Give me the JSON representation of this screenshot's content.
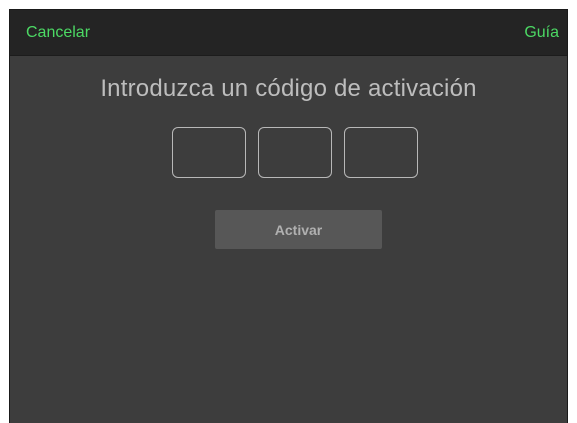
{
  "navbar": {
    "cancel_label": "Cancelar",
    "guide_label": "Guía"
  },
  "main": {
    "title": "Introduzca un código de activación",
    "code_fields": [
      {
        "value": "",
        "placeholder": ""
      },
      {
        "value": "",
        "placeholder": ""
      },
      {
        "value": "",
        "placeholder": ""
      }
    ],
    "activate_label": "Activar"
  },
  "colors": {
    "accent": "#4cd964",
    "background": "#3d3d3d",
    "navbar_background": "#242424",
    "button_background": "#575757"
  }
}
